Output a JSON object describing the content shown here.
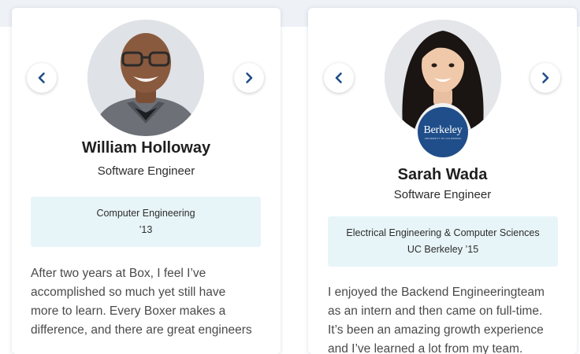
{
  "colors": {
    "accent": "#1f4e8a",
    "info_bg": "#e8f5f8",
    "band": "#eef1f6"
  },
  "icons": {
    "prev": "chevron-left-icon",
    "next": "chevron-right-icon"
  },
  "cards": [
    {
      "name": "William Holloway",
      "role": "Software Engineer",
      "degree": "Computer Engineering",
      "year": "’13",
      "quote_lines": [
        "After two years at Box, I feel I’ve",
        "accomplished so much yet still have",
        "more to learn. Every Boxer makes a",
        "difference, and there are great engineers"
      ]
    },
    {
      "name": "Sarah Wada",
      "role": "Software Engineer",
      "degree": "Electrical Engineering & Computer Sciences",
      "year": "UC Berkeley ’15",
      "badge_text": "Berkeley",
      "badge_sub": "UNIVERSITY OF CALIFORNIA",
      "quote_lines": [
        "I enjoyed the Backend Engineeringteam",
        "as an intern and then came on full-time.",
        "It’s been an amazing growth experience",
        "and I’ve learned a lot from my team."
      ]
    }
  ]
}
